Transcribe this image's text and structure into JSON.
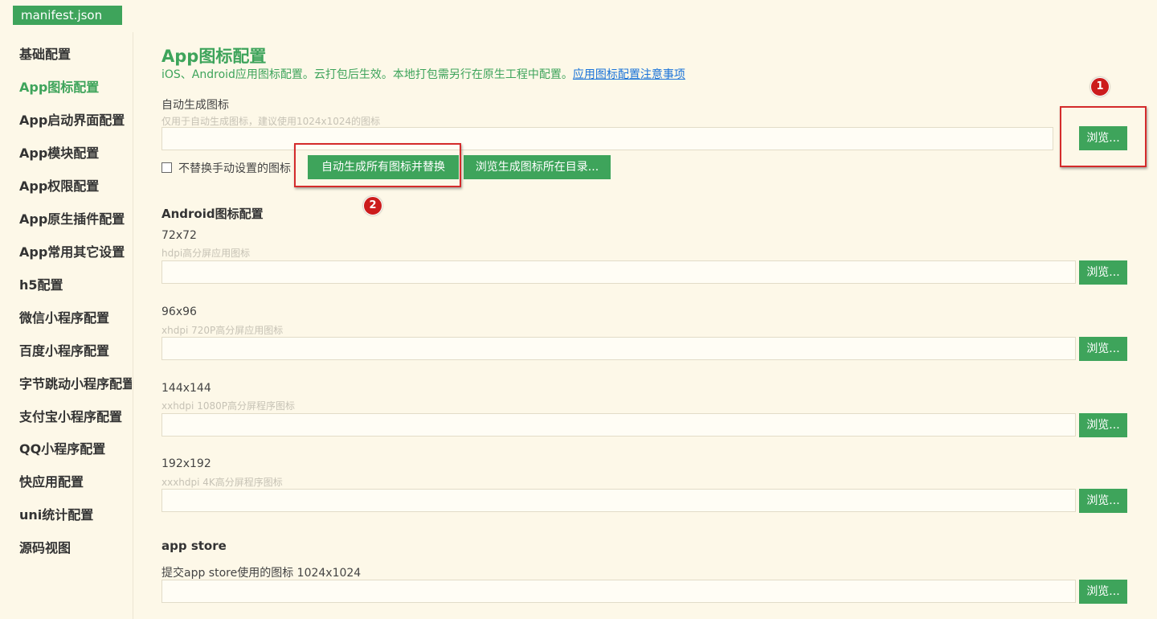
{
  "file_tab": "manifest.json",
  "sidebar": {
    "items": [
      {
        "label": "基础配置",
        "active": false
      },
      {
        "label": "App图标配置",
        "active": true
      },
      {
        "label": "App启动界面配置",
        "active": false
      },
      {
        "label": "App模块配置",
        "active": false
      },
      {
        "label": "App权限配置",
        "active": false
      },
      {
        "label": "App原生插件配置",
        "active": false
      },
      {
        "label": "App常用其它设置",
        "active": false
      },
      {
        "label": "h5配置",
        "active": false
      },
      {
        "label": "微信小程序配置",
        "active": false
      },
      {
        "label": "百度小程序配置",
        "active": false
      },
      {
        "label": "字节跳动小程序配置",
        "active": false
      },
      {
        "label": "支付宝小程序配置",
        "active": false
      },
      {
        "label": "QQ小程序配置",
        "active": false
      },
      {
        "label": "快应用配置",
        "active": false
      },
      {
        "label": "uni统计配置",
        "active": false
      },
      {
        "label": "源码视图",
        "active": false
      }
    ]
  },
  "main": {
    "title": "App图标配置",
    "description": "iOS、Android应用图标配置。云打包后生效。本地打包需另行在原生工程中配置。",
    "description_link": "应用图标配置注意事项",
    "auto_icon": {
      "label": "自动生成图标",
      "hint": "仅用于自动生成图标，建议使用1024x1024的图标",
      "value": "",
      "browse_label": "浏览...",
      "checkbox_label": "不替换手动设置的图标",
      "checkbox_checked": false,
      "generate_button": "自动生成所有图标并替换",
      "browse_dir_button": "浏览生成图标所在目录..."
    },
    "android": {
      "title": "Android图标配置",
      "fields": [
        {
          "label": "72x72",
          "hint": "hdpi高分屏应用图标",
          "value": "",
          "browse_label": "浏览..."
        },
        {
          "label": "96x96",
          "hint": "xhdpi 720P高分屏应用图标",
          "value": "",
          "browse_label": "浏览..."
        },
        {
          "label": "144x144",
          "hint": "xxhdpi 1080P高分屏程序图标",
          "value": "",
          "browse_label": "浏览..."
        },
        {
          "label": "192x192",
          "hint": "xxxhdpi 4K高分屏程序图标",
          "value": "",
          "browse_label": "浏览..."
        }
      ]
    },
    "appstore": {
      "title": "app store",
      "label": "提交app store使用的图标 1024x1024",
      "value": "",
      "browse_label": "浏览..."
    }
  },
  "annotations": {
    "marker_1": "1",
    "marker_2": "2",
    "highlight_color": "#d42b2b"
  },
  "colors": {
    "accent": "#3ea45b",
    "background": "#fdf8e8",
    "link": "#1a73d9"
  }
}
